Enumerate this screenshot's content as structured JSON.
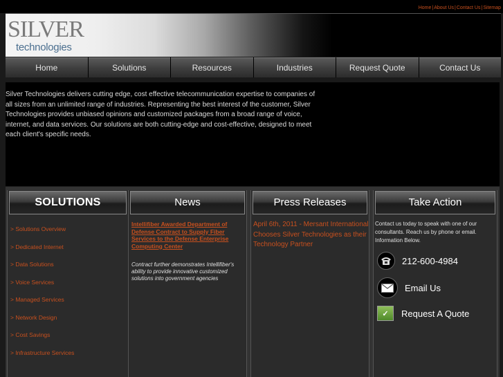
{
  "util_links": [
    "Home",
    "About Us",
    "Contact Us",
    "Sitemap"
  ],
  "logo": {
    "word": "SILVER",
    "sub": "technologies"
  },
  "nav": [
    "Home",
    "Solutions",
    "Resources",
    "Industries",
    "Request Quote",
    "Contact Us"
  ],
  "intro": "Silver Technologies delivers cutting edge, cost effective telecommunication expertise to companies of all sizes from an unlimited range of industries. Representing the best interest of the customer, Silver Technologies provides unbiased opinions and customized packages from a broad range of voice, internet, and data services. Our solutions are both cutting-edge and cost-effective, designed to meet each client's specific needs.",
  "solutions": {
    "heading": "SOLUTIONS",
    "items": [
      "> Solutions Overview",
      "> Dedicated Internet",
      "> Data Solutions",
      "> Voice Services",
      "> Managed Services",
      "> Network Design",
      "> Cost Savings",
      "> Infrastructure Services"
    ]
  },
  "news": {
    "heading": "News",
    "link": "Intellifiber Awarded Department of Defense Contract to Supply Fiber Services to the Defense Enterprise Computing Center",
    "body": "Contract further demonstrates Intellifiber's ability to provide innovative customized solutions into government agencies"
  },
  "press": {
    "heading": "Press Releases",
    "text": "April 6th, 2011 - Mersant International Chooses Silver Technologies as their Technology Partner"
  },
  "action": {
    "heading": "Take Action",
    "text": "Contact us today to speak with one of our consultants. Reach us by phone or email. Information Below.",
    "phone": "212-600-4984",
    "email": "Email Us",
    "quote": "Request A Quote"
  },
  "colors": {
    "accent": "#c8501e",
    "background": "#1a1a1a"
  }
}
